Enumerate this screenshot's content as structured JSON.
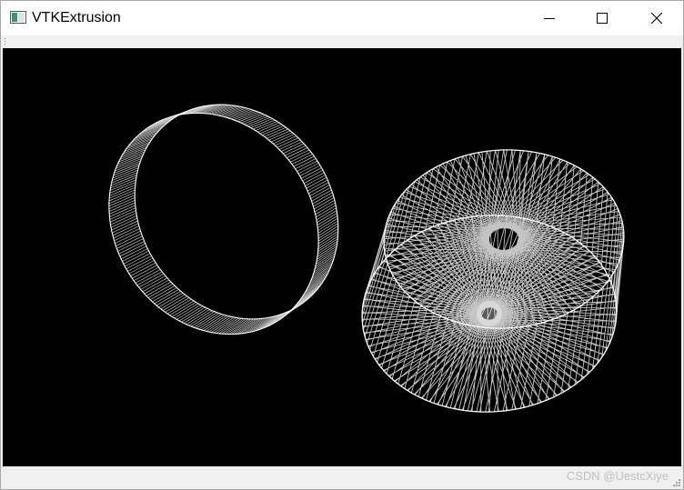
{
  "window": {
    "title": "VTKExtrusion",
    "app_icon": "qt-window-icon",
    "controls": {
      "minimize_icon": "minimize-icon",
      "maximize_icon": "maximize-icon",
      "close_icon": "close-icon"
    }
  },
  "viewport": {
    "background": "#000000",
    "objects": [
      {
        "name": "extruded-ribbon-ring",
        "style": "surface-lines",
        "color": "#d9d9d9"
      },
      {
        "name": "extruded-spiral-cylinder",
        "style": "wireframe",
        "color": "#e6e6e6"
      }
    ]
  },
  "statusbar": {
    "watermark": "CSDN @UestcXiye"
  }
}
